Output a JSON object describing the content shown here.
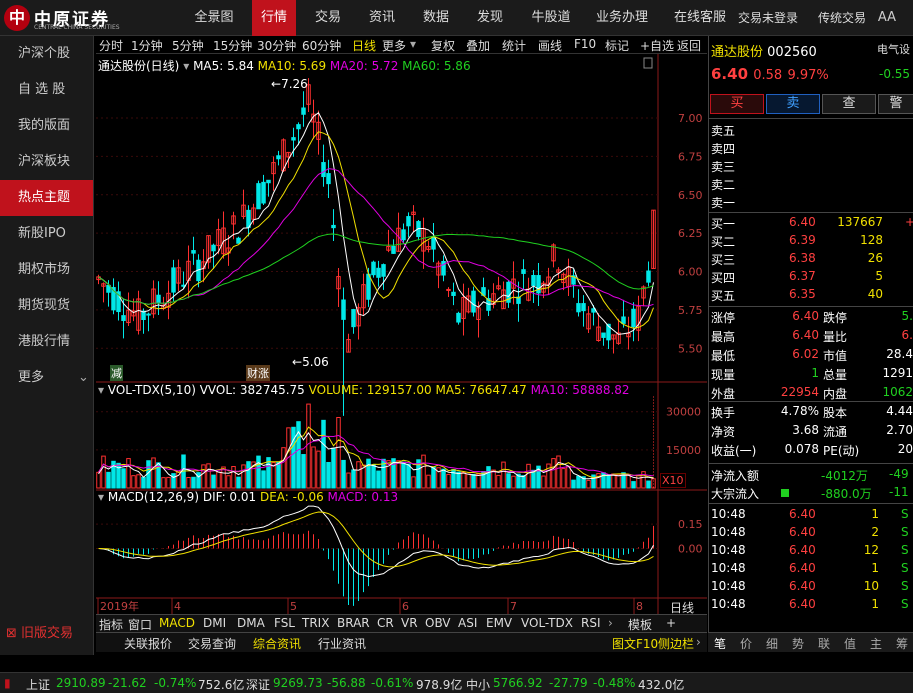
{
  "app": {
    "logo_text": "中原证券",
    "logo_sub": "CENTRAL CHINA SECURITIES",
    "nav": [
      "全景图",
      "行情",
      "交易",
      "资讯",
      "数据",
      "发现",
      "牛股道",
      "业务办理",
      "在线客服"
    ],
    "active_nav": "行情",
    "login_status": "交易未登录",
    "trade_mode": "传统交易",
    "font_size_button": "AA"
  },
  "sidebar": {
    "items": [
      "沪深个股",
      "自 选 股",
      "我的版面",
      "沪深板块",
      "热点主题",
      "新股IPO",
      "期权市场",
      "期货现货",
      "港股行情",
      "更多"
    ],
    "active": "热点主题",
    "old_trade": "旧版交易"
  },
  "chart_toolbar": {
    "periods": [
      "分时",
      "1分钟",
      "5分钟",
      "15分钟",
      "30分钟",
      "60分钟",
      "日线",
      "更多"
    ],
    "active_period": "日线",
    "tools": [
      "复权",
      "叠加",
      "统计",
      "画线",
      "F10",
      "标记",
      "+自选",
      "返回"
    ]
  },
  "colors": {
    "up": "#ff3030",
    "down": "#00e8e8",
    "ma5": "#ffffff",
    "ma10": "#f0e000",
    "ma20": "#e000e0",
    "ma60": "#20d020",
    "accent": "#c0121c"
  },
  "main_chart": {
    "title": "通达股份(日线)",
    "ma5_label": "MA5: 5.84",
    "ma10_label": "MA10: 5.69",
    "ma20_label": "MA20: 5.72",
    "ma60_label": "MA60: 5.86",
    "high_label": "7.26",
    "low_label": "5.06",
    "marker_1": "减",
    "marker_2": "财",
    "marker_3": "涨"
  },
  "vol_chart": {
    "title": "VOL-TDX(5,10)",
    "vvol": "VVOL: 382745.75",
    "volume": "VOLUME: 129157.00",
    "ma5": "MA5: 76647.47",
    "ma10": "MA10: 58888.82",
    "unit": "X10"
  },
  "macd_chart": {
    "title": "MACD(12,26,9)",
    "dif": "DIF: 0.01",
    "dea": "DEA: -0.06",
    "macd": "MACD: 0.13"
  },
  "chart_data": [
    {
      "type": "candlestick",
      "title": "通达股份(日线)",
      "y_ticks": [
        7.0,
        6.75,
        6.5,
        6.25,
        6.0,
        5.75,
        5.5
      ],
      "ylim": [
        5.3,
        7.3
      ],
      "x_labels": [
        "2019年",
        "4",
        "5",
        "6",
        "7",
        "8"
      ],
      "period_label": "日线",
      "highest": 7.26,
      "lowest": 5.06,
      "last_close": 6.4
    },
    {
      "type": "bar",
      "title": "VOL-TDX(5,10)",
      "y_ticks": [
        30000,
        15000
      ],
      "ylim": [
        0,
        35000
      ]
    },
    {
      "type": "bar",
      "title": "MACD(12,26,9)",
      "y_ticks": [
        0.15,
        0.0
      ],
      "ylim": [
        -0.3,
        0.25
      ]
    }
  ],
  "bottom_tabs": [
    "指标",
    "窗口",
    "MACD",
    "DMI",
    "DMA",
    "FSL",
    "TRIX",
    "BRAR",
    "CR",
    "VR",
    "OBV",
    "ASI",
    "EMV",
    "VOL-TDX",
    "RSI",
    "模板",
    "+"
  ],
  "active_bottom_tab": "MACD",
  "footer_nav": [
    "关联报价",
    "交易查询",
    "综合资讯",
    "行业资讯"
  ],
  "footer_right": [
    "图文F10",
    "侧边栏"
  ],
  "quote": {
    "name": "通达股份",
    "code": "002560",
    "price": "6.40",
    "change": "0.58",
    "change_pct": "9.97%",
    "buttons": [
      "买",
      "卖",
      "查",
      "警"
    ],
    "right_label": "电气设",
    "right_value": "-0.55",
    "sells": [
      "卖五",
      "卖四",
      "卖三",
      "卖二",
      "卖一"
    ],
    "buys": [
      {
        "label": "买一",
        "price": "6.40",
        "vol": "137667",
        "extra": "+"
      },
      {
        "label": "买二",
        "price": "6.39",
        "vol": "128",
        "extra": ""
      },
      {
        "label": "买三",
        "price": "6.38",
        "vol": "26",
        "extra": ""
      },
      {
        "label": "买四",
        "price": "6.37",
        "vol": "5",
        "extra": ""
      },
      {
        "label": "买五",
        "price": "6.35",
        "vol": "40",
        "extra": ""
      }
    ],
    "stats": [
      {
        "l1": "涨停",
        "v1": "6.40",
        "l2": "跌停",
        "v2": "5."
      },
      {
        "l1": "最高",
        "v1": "6.40",
        "l2": "量比",
        "v2": "6."
      },
      {
        "l1": "最低",
        "v1": "6.02",
        "l2": "市值",
        "v2": "28.4"
      },
      {
        "l1": "现量",
        "v1": "1",
        "l2": "总量",
        "v2": "1291"
      },
      {
        "l1": "外盘",
        "v1": "22954",
        "l2": "内盘",
        "v2": "1062"
      }
    ],
    "fundamentals": [
      {
        "l1": "换手",
        "v1": "4.78%",
        "l2": "股本",
        "v2": "4.44"
      },
      {
        "l1": "净资",
        "v1": "3.68",
        "l2": "流通",
        "v2": "2.70"
      },
      {
        "l1": "收益(一)",
        "v1": "0.078",
        "l2": "PE(动)",
        "v2": "20"
      }
    ],
    "net_flow_label": "净流入额",
    "net_flow": "-4012万",
    "net_flow_extra": "-49",
    "block_label": "大宗流入",
    "block_flow": "-880.0万",
    "block_extra": "-11",
    "ticks": [
      {
        "time": "10:48",
        "price": "6.40",
        "vol": "1",
        "side": "S"
      },
      {
        "time": "10:48",
        "price": "6.40",
        "vol": "2",
        "side": "S"
      },
      {
        "time": "10:48",
        "price": "6.40",
        "vol": "12",
        "side": "S"
      },
      {
        "time": "10:48",
        "price": "6.40",
        "vol": "1",
        "side": "S"
      },
      {
        "time": "10:48",
        "price": "6.40",
        "vol": "10",
        "side": "S"
      },
      {
        "time": "10:48",
        "price": "6.40",
        "vol": "1",
        "side": "S"
      }
    ],
    "side_tabs": [
      "笔",
      "价",
      "细",
      "势",
      "联",
      "值",
      "主",
      "筹"
    ]
  },
  "statusbar": {
    "sh_label": "上证",
    "sh_index": "2910.89",
    "sh_change": "-21.62",
    "sh_pct": "-0.74%",
    "sh_amount": "752.6亿",
    "sz_label": "深证",
    "sz_index": "9269.73",
    "sz_change": "-56.88",
    "sz_pct": "-0.61%",
    "sz_amount": "978.9亿",
    "zx_label": "中小",
    "zx_index": "5766.92",
    "zx_change": "-27.79",
    "zx_pct": "-0.48%",
    "zx_amount": "432.0亿"
  }
}
